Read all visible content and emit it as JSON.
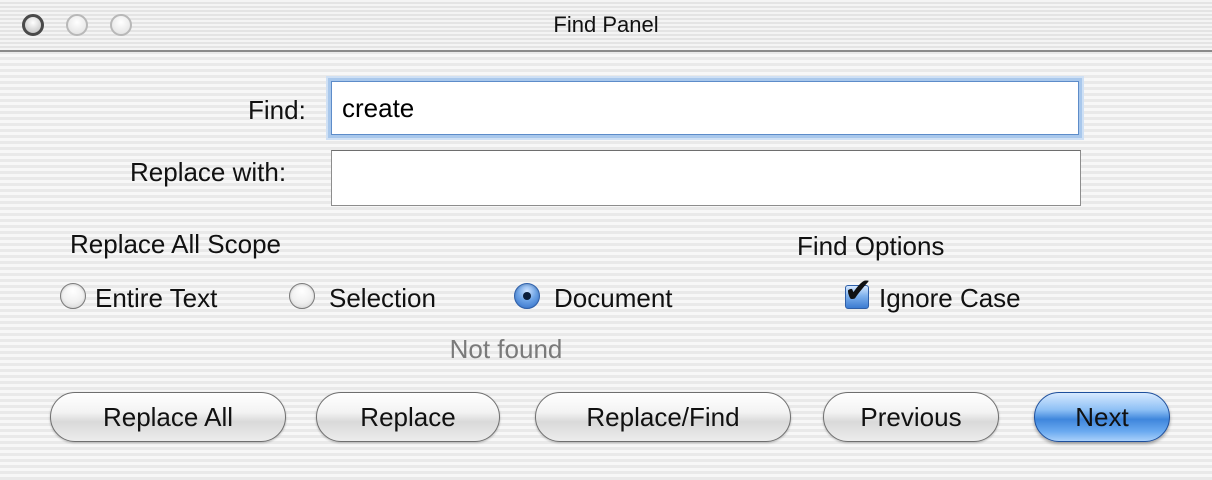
{
  "window": {
    "title": "Find Panel"
  },
  "find": {
    "label": "Find:",
    "value": "create"
  },
  "replace": {
    "label": "Replace with:",
    "value": ""
  },
  "scope": {
    "heading": "Replace All Scope",
    "options": [
      "Entire Text",
      "Selection",
      "Document"
    ],
    "selected": "Document"
  },
  "options": {
    "heading": "Find Options",
    "ignore_case_label": "Ignore Case",
    "ignore_case_checked": true
  },
  "status": {
    "text": "Not found"
  },
  "buttons": {
    "replace_all": "Replace All",
    "replace": "Replace",
    "replace_find": "Replace/Find",
    "previous": "Previous",
    "next": "Next"
  },
  "colors": {
    "default_button": "#3f86dc",
    "focus_ring": "#a9c8ec",
    "status_text": "#7a7a7a"
  }
}
